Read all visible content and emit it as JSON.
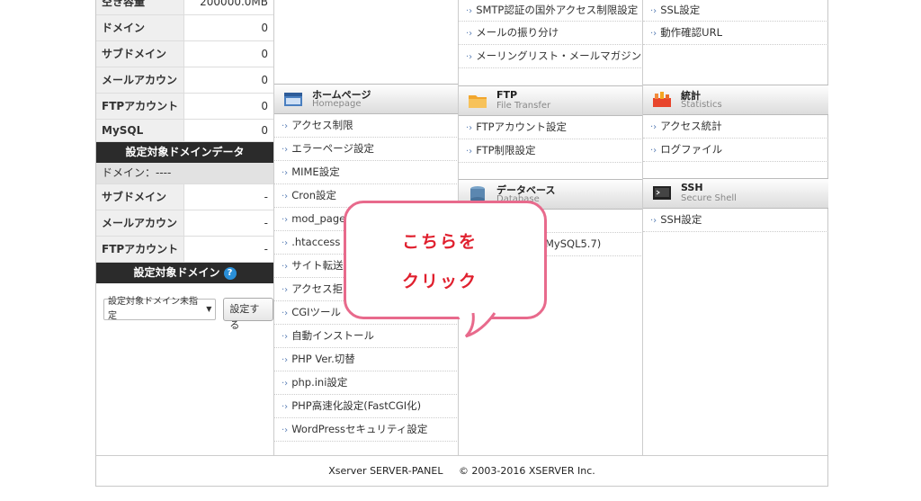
{
  "sidebar": {
    "stats": [
      {
        "label": "空き容量",
        "value": "200000.0MB"
      },
      {
        "label": "ドメイン",
        "value": "0"
      },
      {
        "label": "サブドメイン",
        "value": "0"
      },
      {
        "label": "メールアカウント",
        "value": "0"
      },
      {
        "label": "FTPアカウント",
        "value": "0"
      },
      {
        "label": "MySQL",
        "value": "0"
      }
    ],
    "domain_data_title": "設定対象ドメインデータ",
    "domain_line": "ドメイン：----",
    "domain_stats": [
      {
        "label": "サブドメイン",
        "value": "-"
      },
      {
        "label": "メールアカウント",
        "value": "-"
      },
      {
        "label": "FTPアカウント",
        "value": "-"
      }
    ],
    "target_domain_title": "設定対象ドメイン",
    "help_icon": "?",
    "select_value": "設定対象ドメイン未指定",
    "set_button": "設定する"
  },
  "homepage": {
    "title": "ホームページ",
    "subtitle": "Homepage",
    "items": [
      "アクセス制限",
      "エラーページ設定",
      "MIME設定",
      "Cron設定",
      "mod_page",
      "htaccess",
      "サイト転送",
      "アクセス拒",
      "CGIツール",
      "自動インストール",
      "PHP Ver.切替",
      "php.ini設定",
      "PHP高速化設定(FastCGI化)",
      "WordPressセキュリティ設定"
    ]
  },
  "mail": {
    "items": [
      "SMTP認証の国外アクセス制限設定",
      "メールの振り分け",
      "メーリングリスト・メールマガジン"
    ]
  },
  "ftp": {
    "title": "FTP",
    "subtitle": "File Transfer",
    "items": [
      "FTPアカウント設定",
      "FTP制限設定"
    ]
  },
  "database": {
    "title": "データベース",
    "subtitle": "Database",
    "items": [
      "MySQL5.7)"
    ]
  },
  "domain_col": {
    "items": [
      "SSL設定",
      "動作確認URL"
    ]
  },
  "stats": {
    "title": "統計",
    "subtitle": "Statistics",
    "items": [
      "アクセス統計",
      "ログファイル"
    ]
  },
  "ssh": {
    "title": "SSH",
    "subtitle": "Secure Shell",
    "items": [
      "SSH設定"
    ]
  },
  "footer": {
    "product": "Xserver SERVER-PANEL",
    "copyright": "© 2003-2016 XSERVER Inc."
  },
  "callout": {
    "line1": "こちらを",
    "line2": "クリック",
    "color": "#e0202e",
    "border": "#e86a8c"
  }
}
